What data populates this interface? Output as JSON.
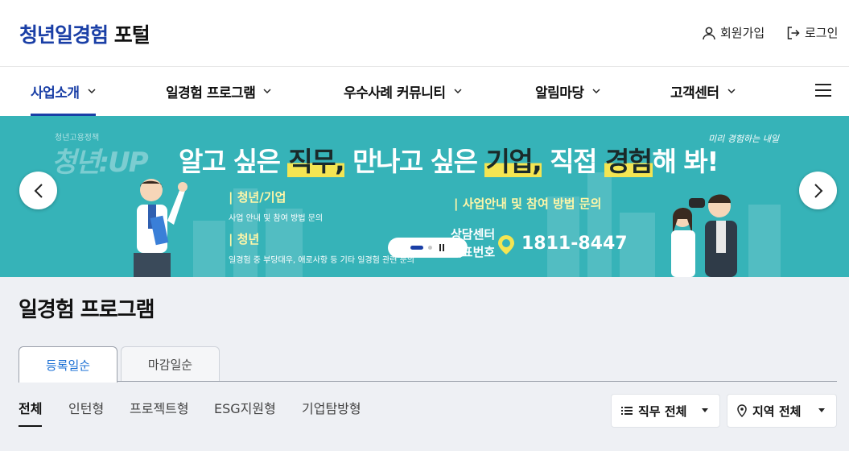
{
  "header": {
    "logo_brand": "청년일경험",
    "logo_rest": " 포털",
    "signup_label": "회원가입",
    "login_label": "로그인"
  },
  "nav": {
    "items": [
      {
        "label": "사업소개"
      },
      {
        "label": "일경험 프로그램"
      },
      {
        "label": "우수사례 커뮤니티"
      },
      {
        "label": "알림마당"
      },
      {
        "label": "고객센터"
      }
    ]
  },
  "banner": {
    "tag": "청년고용정책",
    "up_text": "청년:UP",
    "headline_1": "알고 싶은 ",
    "headline_hl1": "직무,",
    "headline_2": " 만나고 싶은 ",
    "headline_hl2": "기업,",
    "headline_3": " 직접 ",
    "headline_hl3": "경험",
    "headline_4": "해 봐!",
    "left_h1": "| 청년/기업",
    "left_s1": "사업 안내 및 참여 방법 문의",
    "left_h2": "| 청년",
    "left_s2": "일경험 중 부당대우, 애로사항 등 기타 일경험 관련 문의",
    "inquiry": "| 사업안내 및 참여 방법 문의",
    "center_1": "상담센터",
    "center_2": "대표번호",
    "phone": "1811-8447",
    "corner": "미리 경험하는 내일",
    "colors": {
      "background": "#36b3b8",
      "highlight": "#f4e552"
    }
  },
  "section": {
    "title": "일경험 프로그램",
    "sort_tabs": [
      "등록일순",
      "마감일순"
    ],
    "categories": [
      "전체",
      "인턴형",
      "프로젝트형",
      "ESG지원형",
      "기업탐방형"
    ],
    "filters": {
      "job": "직무 전체",
      "region": "지역 전체"
    }
  }
}
